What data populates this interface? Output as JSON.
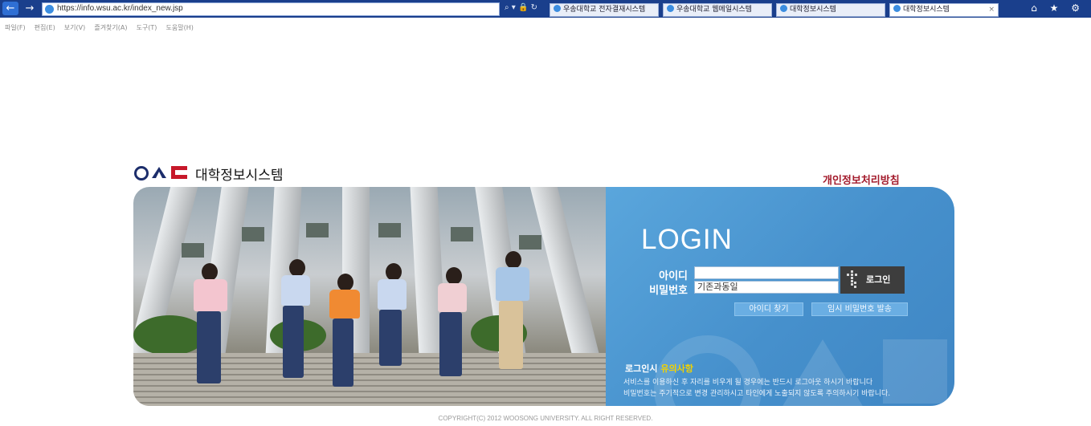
{
  "browser": {
    "address_url": "https://info.wsu.ac.kr/index_new.jsp",
    "address_icons": "⌕ ▾ 🔒 ↻",
    "tabs": [
      {
        "label": "우송대학교 전자결재시스템"
      },
      {
        "label": "우송대학교 웹메일시스템"
      },
      {
        "label": "대학정보시스템"
      },
      {
        "label": "대학정보시스템",
        "active": true
      }
    ],
    "tab_close": "×",
    "right_icons": "⌂ ★ ⚙",
    "menu": [
      "파일(F)",
      "편집(E)",
      "보기(V)",
      "즐겨찾기(A)",
      "도구(T)",
      "도움말(H)"
    ]
  },
  "header": {
    "logo_text": "대학정보시스템",
    "privacy_link": "개인정보처리방침"
  },
  "login": {
    "title": "LOGIN",
    "id_label": "아이디",
    "id_value": "",
    "pw_label": "비밀번호",
    "pw_value": "기존과동일",
    "login_button": "로그인",
    "find_id_button": "아이디 찾기",
    "temp_pw_button": "임시 비밀번호 발송"
  },
  "notice": {
    "title_prefix": "로그인시",
    "title_highlight": "유의사항",
    "lines": [
      "서비스를 이용하신 후 자리를 비우게 될 경우에는 반드시 로그아웃 하시기 바랍니다",
      "비밀번호는 주기적으로 변경 관리하시고 타인에게 노출되지 않도록 주의하시기 바랍니다."
    ]
  },
  "footer": {
    "copyright": "COPYRIGHT(C) 2012 WOOSONG UNIVERSITY.  ALL RIGHT RESERVED."
  },
  "colors": {
    "brand_navy": "#1c2d6b",
    "brand_red": "#c7182a",
    "panel_blue": "#4690cc",
    "privacy_red": "#a31b2c",
    "notice_yellow": "#f2d200"
  }
}
